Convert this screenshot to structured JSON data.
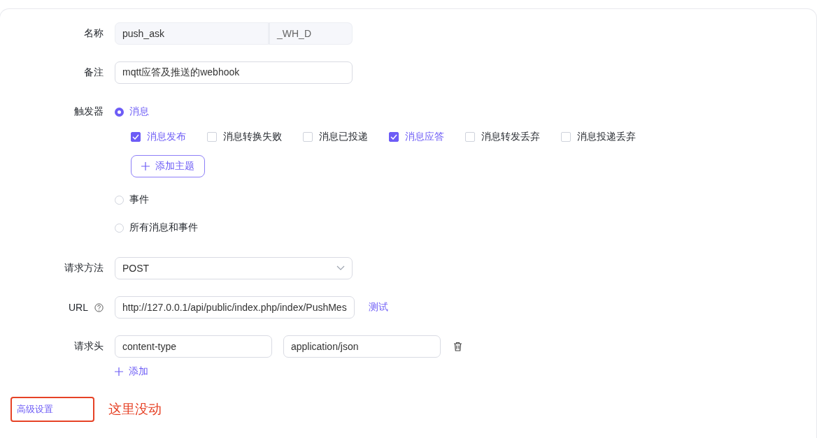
{
  "form": {
    "name": {
      "label": "名称",
      "value": "push_ask",
      "suffix": "_WH_D"
    },
    "remark": {
      "label": "备注",
      "value": "mqtt应答及推送的webhook"
    },
    "trigger": {
      "label": "触发器",
      "options": [
        {
          "label": "消息",
          "selected": true,
          "events": [
            {
              "label": "消息发布",
              "checked": true
            },
            {
              "label": "消息转换失败",
              "checked": false
            },
            {
              "label": "消息已投递",
              "checked": false
            },
            {
              "label": "消息应答",
              "checked": true
            },
            {
              "label": "消息转发丢弃",
              "checked": false
            },
            {
              "label": "消息投递丢弃",
              "checked": false
            }
          ],
          "add_topic_button": "添加主题"
        },
        {
          "label": "事件",
          "selected": false
        },
        {
          "label": "所有消息和事件",
          "selected": false
        }
      ]
    },
    "method": {
      "label": "请求方法",
      "value": "POST"
    },
    "url": {
      "label": "URL",
      "value": "http://127.0.0.1/api/public/index.php/index/PushMes",
      "test_link": "测试"
    },
    "headers": {
      "label": "请求头",
      "rows": [
        {
          "key": "content-type",
          "value": "application/json"
        }
      ],
      "add_button": "添加"
    },
    "advanced_link": "高级设置"
  },
  "annotation": {
    "text": "这里没动"
  }
}
